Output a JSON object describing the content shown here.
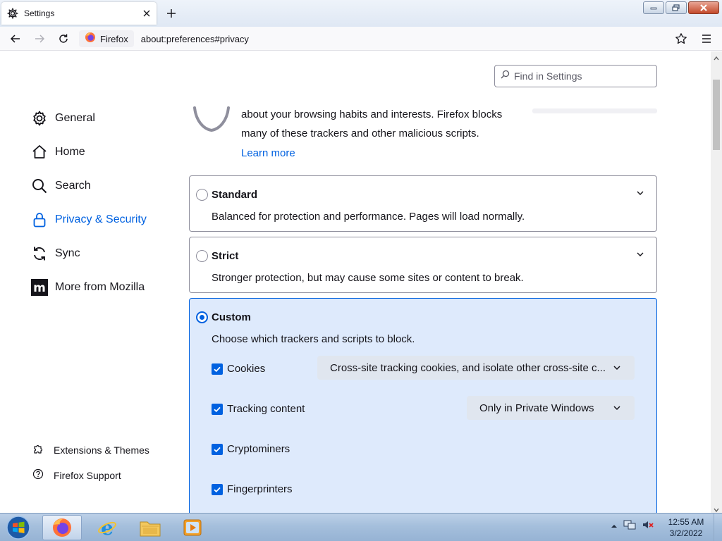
{
  "browser": {
    "tab_title": "Settings",
    "identity_label": "Firefox",
    "url": "about:preferences#privacy"
  },
  "search": {
    "placeholder": "Find in Settings"
  },
  "sidebar": {
    "items": [
      {
        "label": "General",
        "icon": "gear-icon",
        "active": false
      },
      {
        "label": "Home",
        "icon": "home-icon",
        "active": false
      },
      {
        "label": "Search",
        "icon": "search-icon",
        "active": false
      },
      {
        "label": "Privacy & Security",
        "icon": "lock-icon",
        "active": true
      },
      {
        "label": "Sync",
        "icon": "sync-icon",
        "active": false
      },
      {
        "label": "More from Mozilla",
        "icon": "mozilla-icon",
        "active": false
      }
    ],
    "footer": [
      {
        "label": "Extensions & Themes",
        "icon": "puzzle-icon"
      },
      {
        "label": "Firefox Support",
        "icon": "help-icon"
      }
    ]
  },
  "tracking": {
    "desc_line1": "about your browsing habits and interests. Firefox blocks",
    "desc_line2": "many of these trackers and other malicious scripts.",
    "learn_more": "Learn more"
  },
  "categories": {
    "standard": {
      "title": "Standard",
      "desc": "Balanced for protection and performance. Pages will load normally.",
      "selected": false
    },
    "strict": {
      "title": "Strict",
      "desc": "Stronger protection, but may cause some sites or content to break.",
      "selected": false
    },
    "custom": {
      "title": "Custom",
      "desc": "Choose which trackers and scripts to block.",
      "selected": true,
      "options": [
        {
          "label": "Cookies",
          "checked": true,
          "dropdown": "Cross-site tracking cookies, and isolate other cross-site c..."
        },
        {
          "label": "Tracking content",
          "checked": true,
          "dropdown": "Only in Private Windows"
        },
        {
          "label": "Cryptominers",
          "checked": true
        },
        {
          "label": "Fingerprinters",
          "checked": true
        }
      ]
    }
  },
  "taskbar": {
    "time": "12:55 AM",
    "date": "3/2/2022"
  },
  "colors": {
    "accent": "#0061e0",
    "custom_card_bg": "#deeafc"
  }
}
